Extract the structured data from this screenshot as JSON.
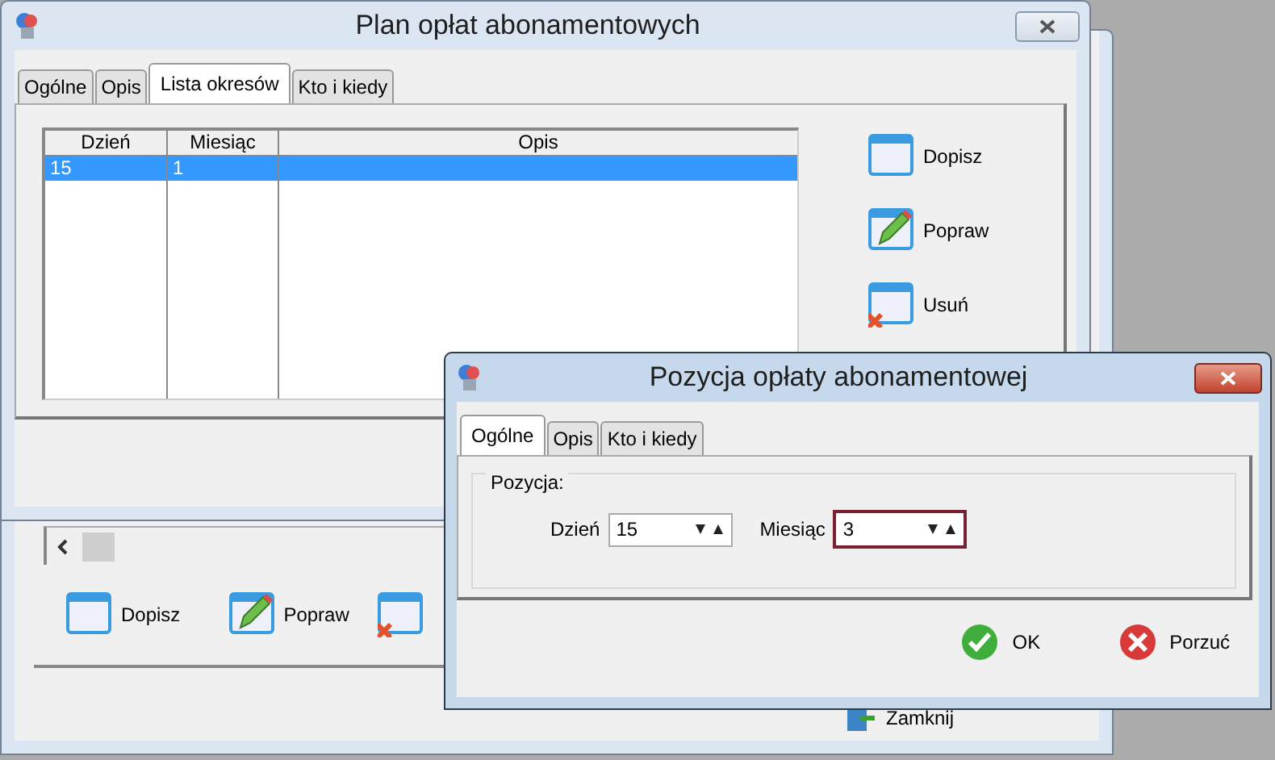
{
  "background_window": {
    "buttons": [
      {
        "label": "Dopisz",
        "kind": "add"
      },
      {
        "label": "Popraw",
        "kind": "edit"
      },
      {
        "kind": "delete"
      }
    ],
    "close_button": {
      "label": "Zamknij"
    }
  },
  "main_window": {
    "title": "Plan opłat abonamentowych",
    "tabs": [
      {
        "label": "Ogólne",
        "selected": false
      },
      {
        "label": "Opis",
        "selected": false
      },
      {
        "label": "Lista okresów",
        "selected": true
      },
      {
        "label": "Kto i kiedy",
        "selected": false
      }
    ],
    "table": {
      "columns": [
        "Dzień",
        "Miesiąc",
        "Opis"
      ],
      "rows": [
        {
          "cells": [
            "15",
            "1"
          ],
          "selected": true
        }
      ]
    },
    "buttons": [
      {
        "label": "Dopisz",
        "kind": "add"
      },
      {
        "label": "Popraw",
        "kind": "edit"
      },
      {
        "label": "Usuń",
        "kind": "delete"
      }
    ]
  },
  "dialog": {
    "title": "Pozycja opłaty abonamentowej",
    "tabs": [
      {
        "label": "Ogólne",
        "selected": true
      },
      {
        "label": "Opis",
        "selected": false
      },
      {
        "label": "Kto i kiedy",
        "selected": false
      }
    ],
    "group": {
      "label": "Pozycja:",
      "fields": [
        {
          "label": "Dzień",
          "value": "15",
          "focused": false
        },
        {
          "label": "Miesiąc",
          "value": "3",
          "focused": true
        }
      ]
    },
    "buttons": [
      {
        "label": "OK",
        "kind": "ok"
      },
      {
        "label": "Porzuć",
        "kind": "cancel"
      }
    ]
  }
}
